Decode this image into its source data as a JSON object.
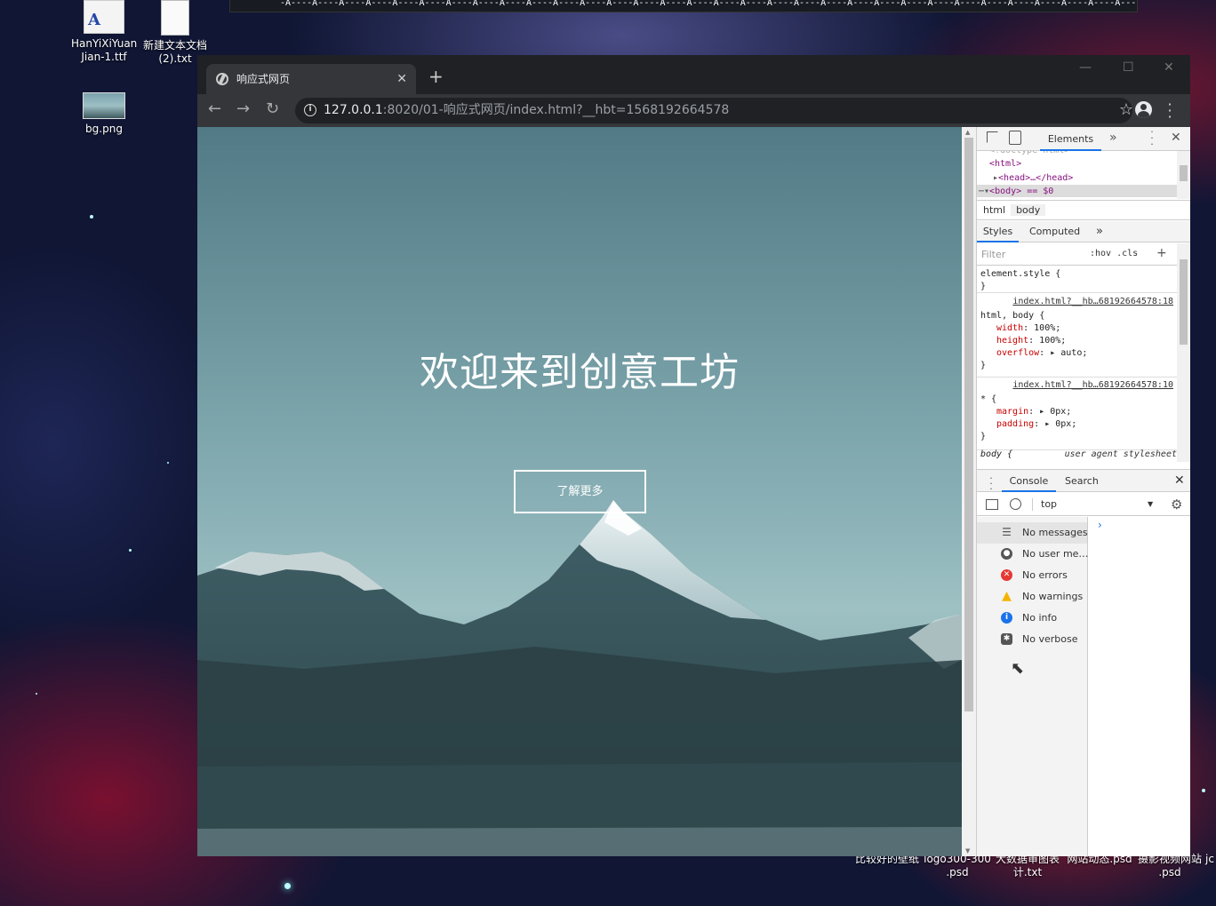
{
  "desktop": {
    "icons": [
      {
        "label": "HanYiXiYuan Jian-1.ttf",
        "name": "font-file-icon"
      },
      {
        "label": "新建文本文档 (2).txt",
        "name": "text-file-icon"
      },
      {
        "label": "bg.png",
        "name": "image-file-icon"
      }
    ],
    "bottom_items": [
      "比较好的壁纸",
      "logo300-300 .psd",
      "大数据审图表 计.txt",
      "网站动态.psd",
      "摄影视频网站 .psd",
      "jc"
    ],
    "top_strip_text": "-A----A----A----A----A----A----A----A----A----A----A----A----A----A----A----A----A----A----A----A----A----A----A----A----A----A----A----A----A----A----A----A---"
  },
  "browser": {
    "tab_title": "响应式网页",
    "tab_close": "✕",
    "new_tab": "+",
    "url_host": "127.0.0.1",
    "url_rest": ":8020/01-响应式网页/index.html?__hbt=1568192664578",
    "window_controls": [
      "—",
      "☐",
      "✕"
    ]
  },
  "page": {
    "title": "欢迎来到创意工坊",
    "button": "了解更多"
  },
  "devtools": {
    "main_tab": "Elements",
    "more_tabs": "»",
    "dom_lines": [
      "<!doctype html>",
      "<html>",
      "<head>…</head>",
      "<body> == $0"
    ],
    "breadcrumb": [
      "html",
      "body"
    ],
    "style_tabs": [
      "Styles",
      "Computed",
      "»"
    ],
    "filter_placeholder": "Filter",
    "hov_cls": ":hov  .cls",
    "rules": {
      "r1_selector": "element.style {",
      "r1_close": "}",
      "r2_source": "index.html?__hb…68192664578:18",
      "r2_selector": "html, body {",
      "r2_props": [
        {
          "name": "width",
          "value": "100%;"
        },
        {
          "name": "height",
          "value": "100%;"
        },
        {
          "name": "overflow",
          "value": "▸ auto;"
        }
      ],
      "r2_close": "}",
      "r3_source": "index.html?__hb…68192664578:10",
      "r3_selector": "* {",
      "r3_props": [
        {
          "name": "margin",
          "value": "▸ 0px;"
        },
        {
          "name": "padding",
          "value": "▸ 0px;"
        }
      ],
      "r3_close": "}",
      "ua_selector": "body {",
      "ua_source": "user agent stylesheet"
    },
    "drawer_tabs": [
      "Console",
      "Search"
    ],
    "context": "top",
    "console_items": [
      {
        "label": "No messages",
        "icon": "list-icon",
        "color": "#555555"
      },
      {
        "label": "No user me…",
        "icon": "user-icon",
        "color": "#555555"
      },
      {
        "label": "No errors",
        "icon": "error-icon",
        "color": "#e53935"
      },
      {
        "label": "No warnings",
        "icon": "warning-icon",
        "color": "#f4b400"
      },
      {
        "label": "No info",
        "icon": "info-icon",
        "color": "#1a73e8"
      },
      {
        "label": "No verbose",
        "icon": "bug-icon",
        "color": "#555555"
      }
    ],
    "prompt": "›"
  }
}
